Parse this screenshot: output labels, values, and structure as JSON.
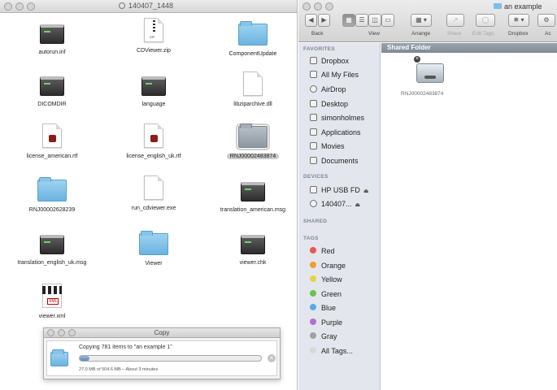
{
  "left_window": {
    "title": "140407_1448",
    "files": [
      {
        "name": "autorun.inf",
        "kind": "exe"
      },
      {
        "name": "CDViewer.zip",
        "kind": "zip",
        "badge": "ZIP"
      },
      {
        "name": "ComponentUpdate",
        "kind": "folder"
      },
      {
        "name": "DICOMDIR",
        "kind": "exe"
      },
      {
        "name": "language",
        "kind": "exe"
      },
      {
        "name": "libziparchive.dll",
        "kind": "doc"
      },
      {
        "name": "license_american.rtf",
        "kind": "rtf"
      },
      {
        "name": "license_english_uk.rtf",
        "kind": "rtf"
      },
      {
        "name": "RNJ00002483874",
        "kind": "folder-gray",
        "selected": true
      },
      {
        "name": "RNJ00002628239",
        "kind": "folder"
      },
      {
        "name": "run_cdviewer.exe",
        "kind": "doc"
      },
      {
        "name": "translation_american.msg",
        "kind": "exe"
      },
      {
        "name": "translation_english_uk.msg",
        "kind": "exe"
      },
      {
        "name": "Viewer",
        "kind": "folder"
      },
      {
        "name": "viewer.chk",
        "kind": "exe"
      },
      {
        "name": "viewer.xml",
        "kind": "xml"
      }
    ]
  },
  "copy_dialog": {
    "title": "Copy",
    "message": "Copying 781 items to \"an example 1\"",
    "detail": "27.0 MB of 504.6 MB – About 3 minutes",
    "progress_fraction": 0.054,
    "cancel_icon": "×"
  },
  "right_window": {
    "title": "an example",
    "toolbar": {
      "back_label": "Back",
      "view_label": "View",
      "arrange_label": "Arrange",
      "share_label": "Share",
      "edit_tags_label": "Edit Tags",
      "dropbox_label": "Dropbox",
      "action_label": "Ac"
    },
    "sidebar": {
      "favorites_header": "FAVORITES",
      "favorites": [
        "Dropbox",
        "All My Files",
        "AirDrop",
        "Desktop",
        "simonholmes",
        "Applications",
        "Movies",
        "Documents"
      ],
      "devices_header": "DEVICES",
      "devices": [
        "HP USB FD",
        "140407..."
      ],
      "shared_header": "SHARED",
      "tags_header": "TAGS",
      "tags": [
        {
          "name": "Red",
          "color": "#e8584f"
        },
        {
          "name": "Orange",
          "color": "#f39a34"
        },
        {
          "name": "Yellow",
          "color": "#e6d43c"
        },
        {
          "name": "Green",
          "color": "#6cc24a"
        },
        {
          "name": "Blue",
          "color": "#5aa7e8"
        },
        {
          "name": "Purple",
          "color": "#b36fd4"
        },
        {
          "name": "Gray",
          "color": "#a0a0a0"
        },
        {
          "name": "All Tags...",
          "color": "#d8d8d8"
        }
      ]
    },
    "path_bar_label": "Shared Folder",
    "disk_image": {
      "name": "RNJ00002483874",
      "badge": "×"
    }
  }
}
